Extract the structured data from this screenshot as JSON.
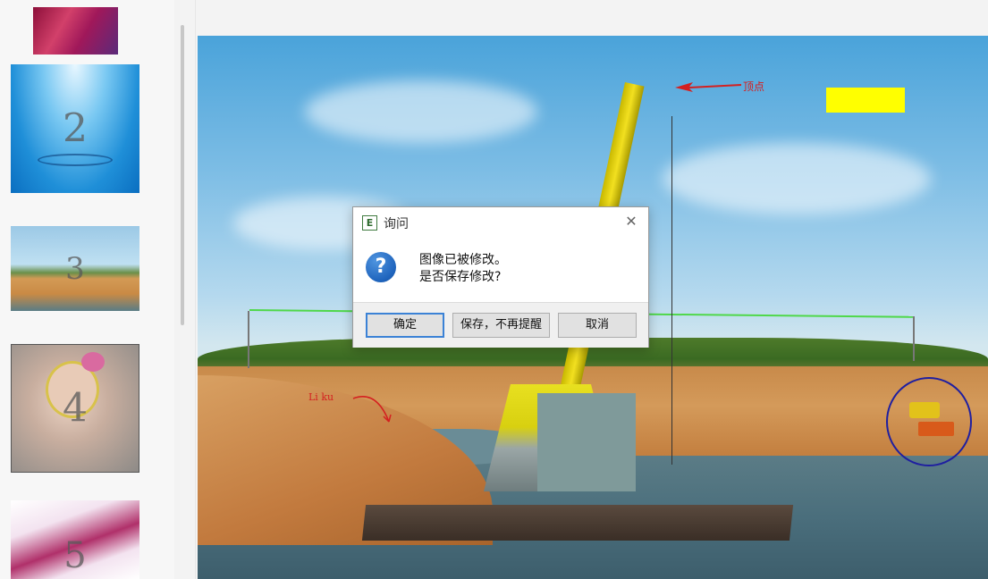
{
  "thumbnails": [
    {
      "number": ""
    },
    {
      "number": "2"
    },
    {
      "number": "3"
    },
    {
      "number": "4"
    },
    {
      "number": "5"
    }
  ],
  "canvas": {
    "annotations": {
      "top_label": "顶点",
      "left_label": "Li ku"
    },
    "colors": {
      "highlight_rect": "#ffff00",
      "arrow": "#d42020",
      "circle": "#1f1fa0",
      "powerline": "#4fd84a"
    }
  },
  "dialog": {
    "title": "询问",
    "app_icon_letter": "E",
    "question_icon_glyph": "?",
    "message_line1": "图像已被修改。",
    "message_line2": "是否保存修改?",
    "buttons": {
      "ok": "确定",
      "save_no_remind": "保存，不再提醒",
      "cancel": "取消"
    }
  }
}
